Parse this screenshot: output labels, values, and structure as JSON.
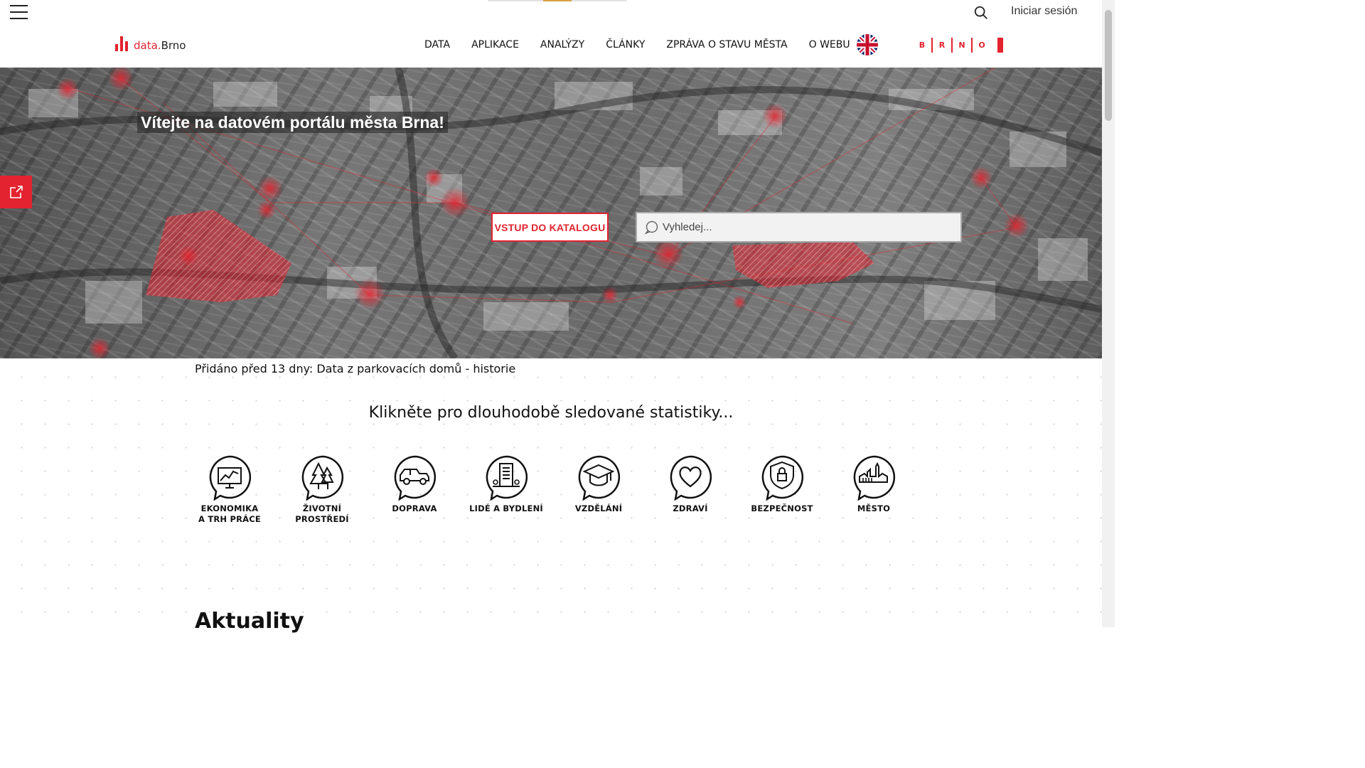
{
  "header": {
    "login_label": "Iniciar sesión",
    "logo": {
      "prefix": "data.",
      "suffix": "Brno"
    },
    "nav": [
      {
        "label": "DATA"
      },
      {
        "label": "APLIKACE"
      },
      {
        "label": "ANALÝZY"
      },
      {
        "label": "ČLÁNKY"
      },
      {
        "label": "ZPRÁVA O STAVU MĚSTA"
      },
      {
        "label": "O WEBU"
      }
    ],
    "city_logo_letters": [
      "B",
      "R",
      "N",
      "O"
    ],
    "language_flag": "uk-flag-icon"
  },
  "hero": {
    "title": "Vítejte na datovém portálu města Brna!",
    "catalog_button": "VSTUP DO KATALOGU",
    "search_placeholder": "Vyhledej..."
  },
  "news": {
    "text": "Přidáno před 13 dny: Data z parkovacích domů - historie"
  },
  "stats": {
    "heading": "Klikněte pro dlouhodobě sledované statistiky...",
    "items": [
      {
        "line1": "EKONOMIKA",
        "line2": "A TRH PRÁCE",
        "icon": "economy-chart-icon"
      },
      {
        "line1": "ŽIVOTNÍ",
        "line2": "PROSTŘEDÍ",
        "icon": "tree-icon"
      },
      {
        "line1": "DOPRAVA",
        "line2": "",
        "icon": "car-icon"
      },
      {
        "line1": "LIDÉ A BYDLENÍ",
        "line2": "",
        "icon": "building-icon"
      },
      {
        "line1": "VZDĚLÁNÍ",
        "line2": "",
        "icon": "graduation-cap-icon"
      },
      {
        "line1": "ZDRAVÍ",
        "line2": "",
        "icon": "heart-icon"
      },
      {
        "line1": "BEZPEČNOST",
        "line2": "",
        "icon": "shield-lock-icon"
      },
      {
        "line1": "MĚSTO",
        "line2": "",
        "icon": "cityscape-icon"
      }
    ]
  },
  "sections": {
    "news_title": "Aktuality"
  },
  "colors": {
    "accent": "#e3232f",
    "text": "#111111"
  }
}
